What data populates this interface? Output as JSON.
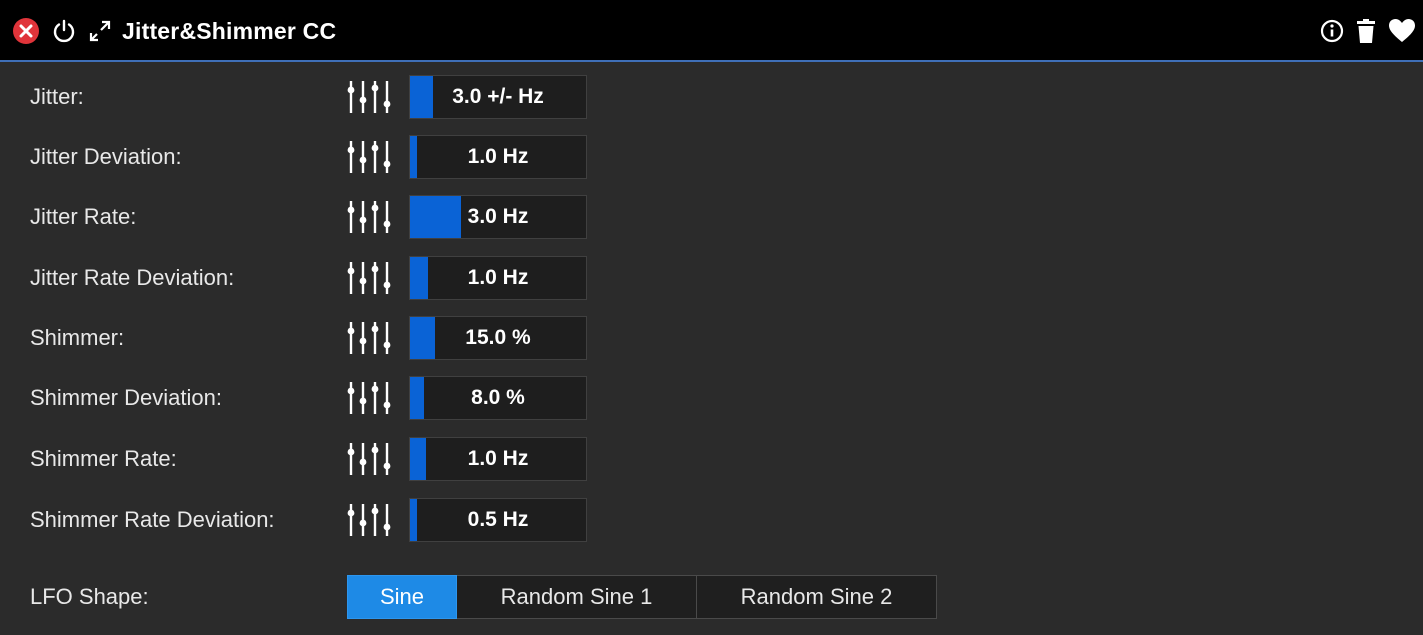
{
  "window": {
    "title": "Jitter&Shimmer CC",
    "icons": [
      "close-icon",
      "power-icon",
      "expand-icon",
      "info-icon",
      "trash-icon",
      "heart-icon"
    ]
  },
  "params": [
    {
      "label": "Jitter:",
      "value": "3.0 +/- Hz",
      "level": 0.13
    },
    {
      "label": "Jitter Deviation:",
      "value": "1.0 Hz",
      "level": 0.04
    },
    {
      "label": "Jitter Rate:",
      "value": "3.0 Hz",
      "level": 0.29
    },
    {
      "label": "Jitter Rate Deviation:",
      "value": "1.0 Hz",
      "level": 0.1
    },
    {
      "label": "Shimmer:",
      "value": "15.0 %",
      "level": 0.14
    },
    {
      "label": "Shimmer Deviation:",
      "value": "8.0 %",
      "level": 0.08
    },
    {
      "label": "Shimmer Rate:",
      "value": "1.0 Hz",
      "level": 0.09
    },
    {
      "label": "Shimmer Rate Deviation:",
      "value": "0.5 Hz",
      "level": 0.04
    }
  ],
  "lfo": {
    "label": "LFO Shape:",
    "options": [
      "Sine",
      "Random Sine 1",
      "Random Sine 2"
    ],
    "selected": "Sine"
  },
  "colors": {
    "accent": "#0a63d6",
    "selected_button": "#1e8ae6",
    "close_button": "#e0343a",
    "titlebar_border": "#3f6fb7"
  }
}
